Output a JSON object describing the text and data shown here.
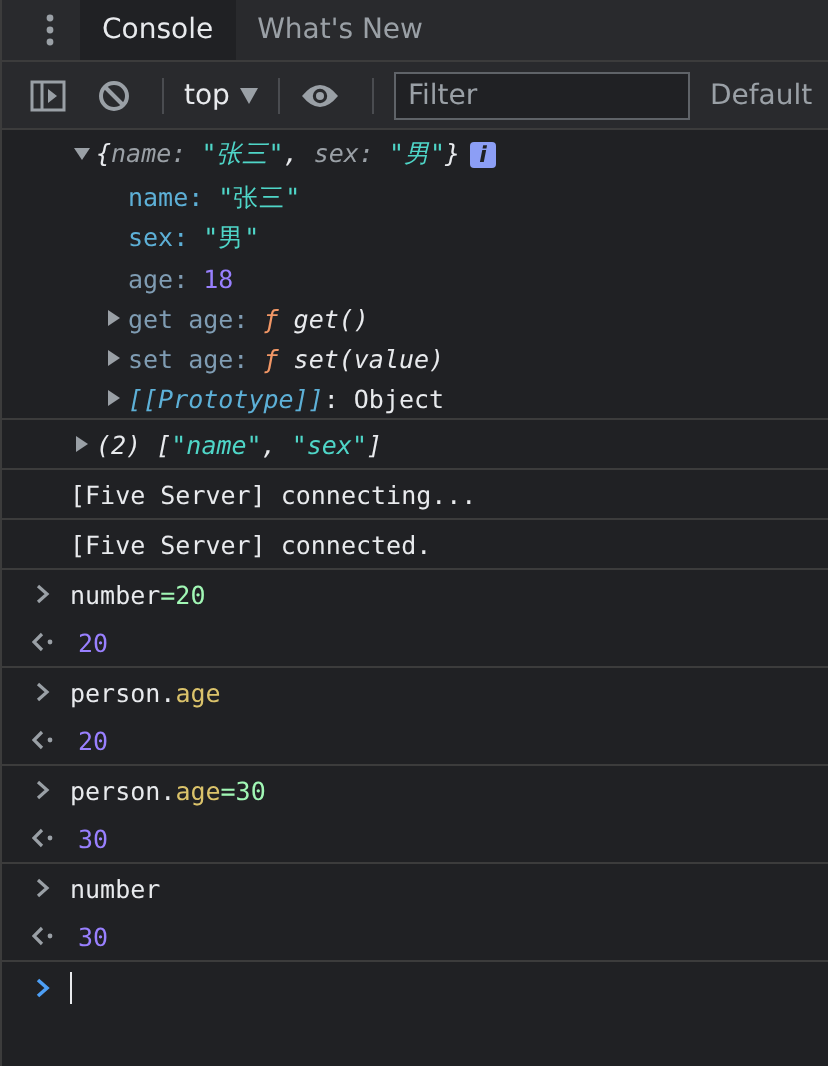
{
  "tabs": [
    {
      "label": "Console",
      "selected": true
    },
    {
      "label": "What's New",
      "selected": false
    }
  ],
  "toolbar": {
    "context": "top",
    "filter": {
      "placeholder": "Filter"
    },
    "levels": "Default"
  },
  "entries": [
    {
      "kind": "object",
      "expanded": true,
      "italic": true,
      "badge": "i",
      "tokens": [
        {
          "text": "{",
          "kind": "plain"
        },
        {
          "text": "name: ",
          "kind": "muted"
        },
        {
          "text": "\"张三\"",
          "kind": "string"
        },
        {
          "text": ", ",
          "kind": "plain"
        },
        {
          "text": "sex: ",
          "kind": "muted"
        },
        {
          "text": "\"男\"",
          "kind": "string"
        },
        {
          "text": "}",
          "kind": "plain"
        }
      ],
      "children": [
        {
          "kind": "value",
          "tokens": [
            {
              "text": "name: ",
              "kind": "key"
            },
            {
              "text": "\"张三\"",
              "kind": "string"
            }
          ]
        },
        {
          "kind": "value",
          "tokens": [
            {
              "text": "sex: ",
              "kind": "key"
            },
            {
              "text": "\"男\"",
              "kind": "string"
            }
          ]
        },
        {
          "kind": "value",
          "tokens": [
            {
              "text": "age: ",
              "kind": "dimkey"
            },
            {
              "text": "18",
              "kind": "number"
            }
          ]
        },
        {
          "kind": "group",
          "expanded": false,
          "tokens": [
            {
              "text": "get age: ",
              "kind": "dimkey"
            },
            {
              "text": "ƒ ",
              "kind": "fnmark"
            },
            {
              "text": "get()",
              "kind": "signature"
            }
          ]
        },
        {
          "kind": "group",
          "expanded": false,
          "tokens": [
            {
              "text": "set age: ",
              "kind": "dimkey"
            },
            {
              "text": "ƒ ",
              "kind": "fnmark"
            },
            {
              "text": "set(value)",
              "kind": "signature"
            }
          ]
        },
        {
          "kind": "group",
          "expanded": false,
          "tokens": [
            {
              "text": "[[Prototype]]",
              "kind": "proto"
            },
            {
              "text": ": Object",
              "kind": "plain"
            }
          ]
        }
      ]
    },
    {
      "kind": "object",
      "expanded": false,
      "italic": true,
      "tokens": [
        {
          "text": "(2) [",
          "kind": "plain"
        },
        {
          "text": "\"name\"",
          "kind": "string"
        },
        {
          "text": ", ",
          "kind": "plain"
        },
        {
          "text": "\"sex\"",
          "kind": "string"
        },
        {
          "text": "]",
          "kind": "plain"
        }
      ]
    },
    {
      "kind": "log",
      "tokens": [
        {
          "text": "[Five Server] connecting...",
          "kind": "plain"
        }
      ]
    },
    {
      "kind": "log",
      "tokens": [
        {
          "text": "[Five Server] connected.",
          "kind": "plain"
        }
      ]
    },
    {
      "kind": "input",
      "tokens": [
        {
          "text": "number",
          "kind": "plain"
        },
        {
          "text": "=20",
          "kind": "literal"
        }
      ]
    },
    {
      "kind": "result",
      "tokens": [
        {
          "text": "20",
          "kind": "number"
        }
      ]
    },
    {
      "kind": "input",
      "tokens": [
        {
          "text": "person.",
          "kind": "plain"
        },
        {
          "text": "age",
          "kind": "prop"
        }
      ]
    },
    {
      "kind": "result",
      "tokens": [
        {
          "text": "20",
          "kind": "number"
        }
      ]
    },
    {
      "kind": "input",
      "tokens": [
        {
          "text": "person.",
          "kind": "plain"
        },
        {
          "text": "age",
          "kind": "prop"
        },
        {
          "text": "=30",
          "kind": "literal"
        }
      ]
    },
    {
      "kind": "result",
      "tokens": [
        {
          "text": "30",
          "kind": "number"
        }
      ]
    },
    {
      "kind": "input",
      "tokens": [
        {
          "text": "number",
          "kind": "plain"
        }
      ]
    },
    {
      "kind": "result",
      "tokens": [
        {
          "text": "30",
          "kind": "number"
        }
      ]
    },
    {
      "kind": "prompt"
    }
  ]
}
